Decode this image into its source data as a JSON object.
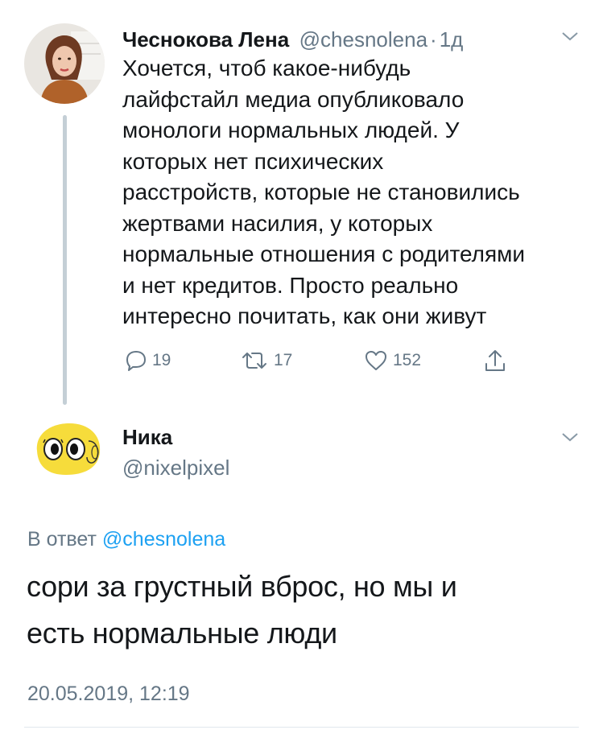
{
  "tweet1": {
    "author_name": "Чеснокова Лена",
    "author_handle": "@chesnolena",
    "time_sep": "·",
    "time": "1д",
    "text": "Хочется, чтоб какое-нибудь\nлайфстайл медиа опубликовало\nмонологи нормальных людей. У\nкоторых нет психических\nрасстройств, которые не становились\nжертвами насилия, у которых\nнормальные отношения с родителями\nи нет кредитов. Просто реально\nинтересно почитать, как они живут",
    "replies": "19",
    "retweets": "17",
    "likes": "152"
  },
  "tweet2": {
    "author_name": "Ника",
    "author_handle": "@nixelpixel",
    "reply_prefix": "В ответ",
    "reply_mention": "@chesnolena",
    "text_line1": "сори за грустный вброс, но мы и",
    "text_line2": "есть нормальные люди",
    "timestamp": "20.05.2019, 12:19"
  },
  "icons": {
    "reply": "reply-icon",
    "retweet": "retweet-icon",
    "like": "heart-icon",
    "share": "share-icon",
    "menu": "chevron-down-icon"
  },
  "colors": {
    "text": "#14171a",
    "secondary": "#657786",
    "link": "#1da1f2",
    "thread_line": "#c4cfd6"
  }
}
